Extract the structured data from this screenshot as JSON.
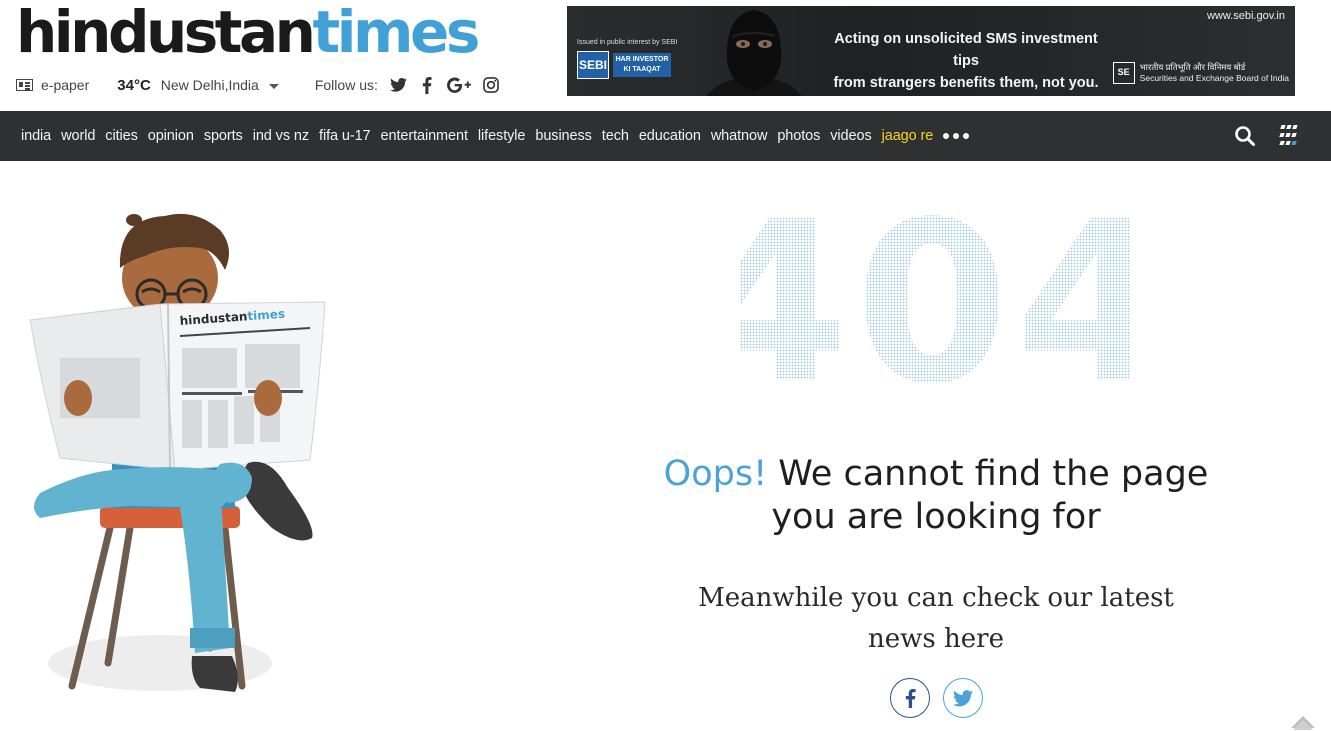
{
  "header": {
    "logo": {
      "part1": "hindustan",
      "part2": "times"
    },
    "epaper_label": "e-paper",
    "temperature": "34°C",
    "city": "New Delhi,India",
    "follow_label": "Follow us:",
    "social_icons": [
      "twitter-icon",
      "facebook-icon",
      "google-plus-icon",
      "instagram-icon"
    ]
  },
  "ad": {
    "issued": "Issued in public interest by SEBI",
    "sebi_short": "SEBI",
    "har_investor": "HAR INVESTOR KI TAAQAT",
    "message_line1": "Acting on unsolicited SMS investment tips",
    "message_line2": "from strangers benefits them, not you.",
    "url": "www.sebi.gov.in",
    "sebi_hindi": "भारतीय प्रतिभूति और विनिमय बोर्ड",
    "sebi_english": "Securities and Exchange Board of India"
  },
  "nav": {
    "items": [
      "india",
      "world",
      "cities",
      "opinion",
      "sports",
      "ind vs nz",
      "fifa u-17",
      "entertainment",
      "lifestyle",
      "business",
      "tech",
      "education",
      "whatnow",
      "photos",
      "videos"
    ],
    "highlight_item": "jaago re",
    "highlight_color": "#f7d31a",
    "background": "#2f3032"
  },
  "main": {
    "code": "404",
    "oops_blue": "Oops!",
    "oops_rest": "We cannot find the page you are looking for",
    "meanwhile": "Meanwhile you can check our latest news here",
    "illustration_newspaper_title": "hindustantimes",
    "share_icons": [
      "facebook-icon",
      "twitter-icon"
    ],
    "accent_color": "#4aa3d8"
  }
}
